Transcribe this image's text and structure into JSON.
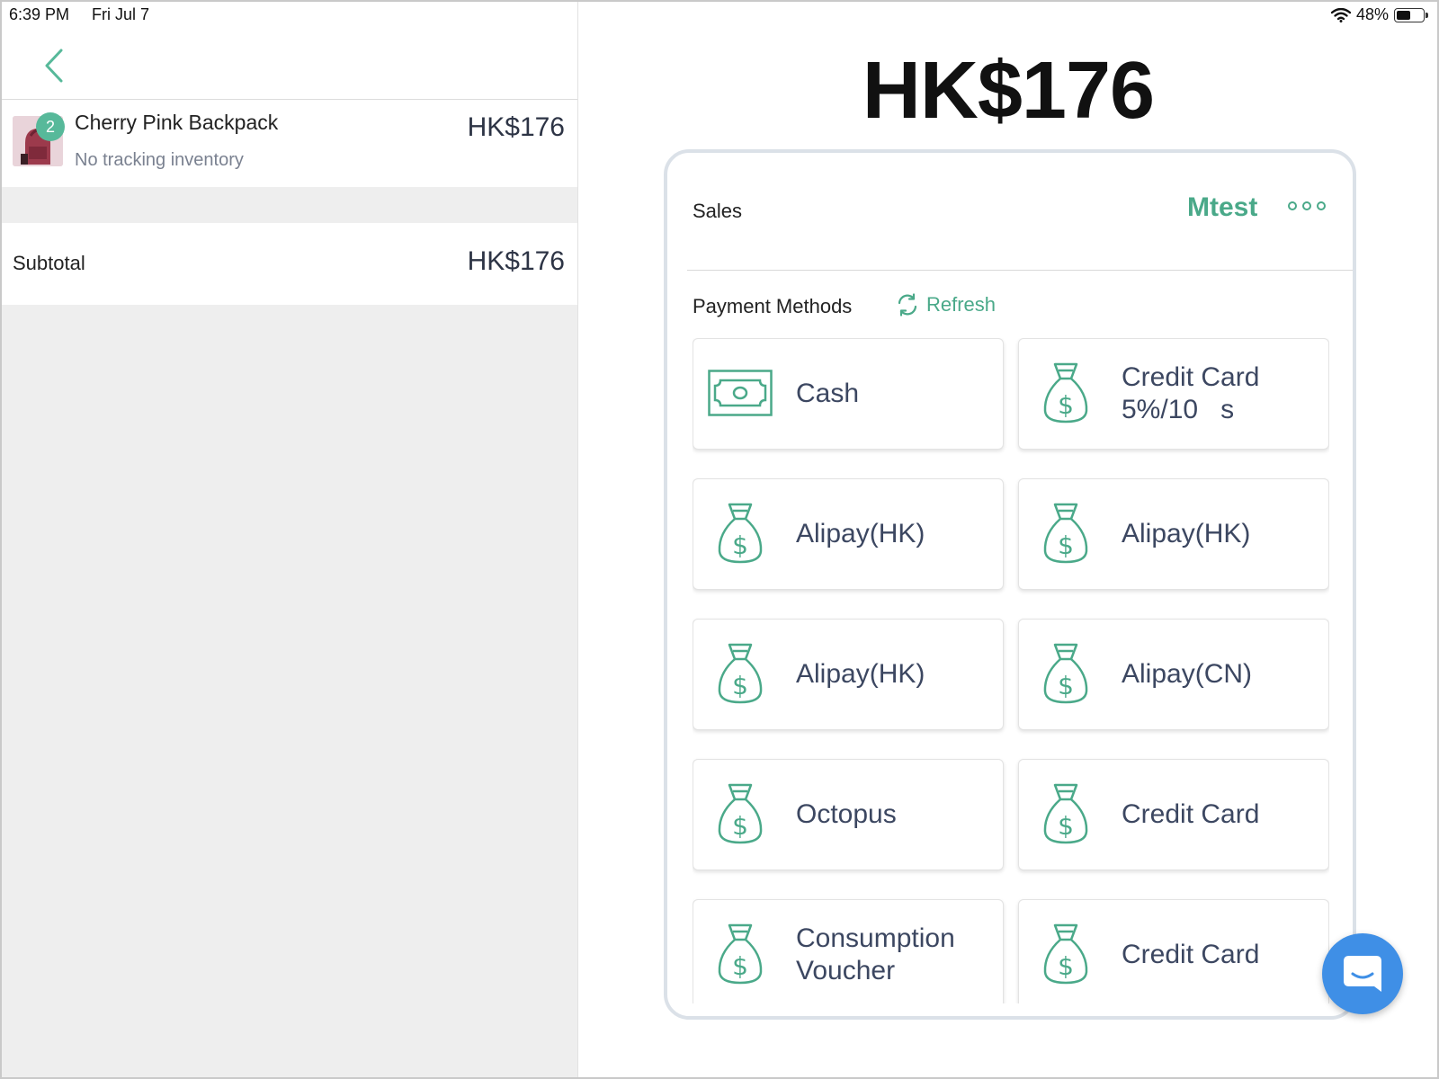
{
  "status_bar": {
    "time": "6:39 PM",
    "date": "Fri Jul 7",
    "battery_percent": "48%",
    "battery_level": 0.48
  },
  "cart": {
    "item": {
      "quantity": "2",
      "name": "Cherry Pink Backpack",
      "subtitle": "No tracking inventory",
      "price": "HK$176"
    },
    "subtotal_label": "Subtotal",
    "subtotal_value": "HK$176"
  },
  "checkout": {
    "total": "HK$176",
    "sales_label": "Sales",
    "sales_user": "Mtest",
    "payment_methods_label": "Payment Methods",
    "refresh_label": "Refresh",
    "methods": [
      {
        "line1": "Cash",
        "line2": "",
        "icon": "cash-icon"
      },
      {
        "line1": "Credit Card",
        "line2": "5%/10   s",
        "icon": "money-bag-icon"
      },
      {
        "line1": "Alipay(HK)",
        "line2": "",
        "icon": "money-bag-icon"
      },
      {
        "line1": "Alipay(HK)",
        "line2": "",
        "icon": "money-bag-icon"
      },
      {
        "line1": "Alipay(HK)",
        "line2": "",
        "icon": "money-bag-icon"
      },
      {
        "line1": "Alipay(CN)",
        "line2": "",
        "icon": "money-bag-icon"
      },
      {
        "line1": "Octopus",
        "line2": "",
        "icon": "money-bag-icon"
      },
      {
        "line1": "Credit Card",
        "line2": "",
        "icon": "money-bag-icon"
      },
      {
        "line1": "Consumption",
        "line2": "Voucher",
        "icon": "money-bag-icon"
      },
      {
        "line1": "Credit Card",
        "line2": "",
        "icon": "money-bag-icon"
      }
    ]
  },
  "colors": {
    "accent": "#4aa989",
    "badge": "#57b99a",
    "chat_button": "#3f8fe6",
    "method_text": "#3c4761"
  }
}
